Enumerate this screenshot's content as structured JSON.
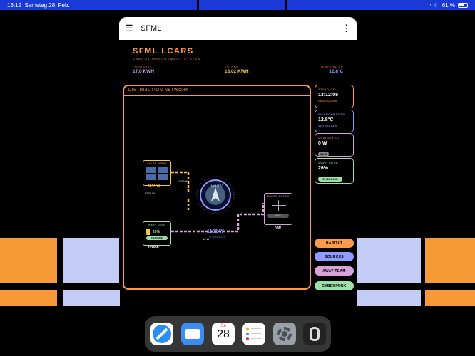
{
  "statusbar": {
    "time": "13:12",
    "date": "Samstag 28. Feb.",
    "battery": "61 %"
  },
  "app": {
    "title": "SFML",
    "brand": "SFML LCARS",
    "brand_sub": "ENERGY MANAGEMENT SYSTEM",
    "metrics": [
      {
        "label": "PROGNOSE",
        "value": "17.0 KWH"
      },
      {
        "label": "ERTRAG",
        "value": "13.02 KWH"
      },
      {
        "label": "TEMPERATUR",
        "value": "12.8°C"
      }
    ]
  },
  "network": {
    "title": "DISTRIBUTION NETWORK",
    "solar": {
      "label": "SOLAR ARRAY",
      "value": "6130 W",
      "flow": "4226 W"
    },
    "warp": {
      "label": "WARP CORE",
      "percent": "26%",
      "state": "CHARGING",
      "value": "4236 W"
    },
    "habitat": {
      "label": "HABITAT",
      "value": "1132 W",
      "sub": "VERBRAUCH"
    },
    "grid": {
      "label": "POWER MATRIX",
      "state": "IDLE",
      "value": "0 W"
    },
    "flow_solar_habitat": "1132 W",
    "flow_warp_grid": "10 W"
  },
  "cards": {
    "stardate": {
      "label": "STARDATE",
      "value": "13:12:08",
      "sub": "SA 28.02.2026"
    },
    "environmental": {
      "label": "ENVIRONMENTAL",
      "value": "12.8°C",
      "sub": "41% WOLKEN"
    },
    "grid": {
      "label": "GRID STATUS",
      "value": "0 W",
      "pill": "IDLE"
    },
    "warp": {
      "label": "WARP CORE",
      "value": "26%",
      "pill": "CHARGING"
    }
  },
  "nav": [
    "HABITAT",
    "SOURCES",
    "AWAY TEAM",
    "CYBERPUNK"
  ],
  "dock": {
    "calendar_day": "Sa",
    "calendar_date": "28",
    "icons": [
      "safari-icon",
      "mail-icon",
      "calendar-icon",
      "reminders-icon",
      "settings-icon",
      "app-icon"
    ]
  },
  "colors": {
    "orange": "#ff9a4a",
    "blue": "#8f9bff",
    "lavender": "#c8a2e8",
    "green": "#9fe0a8",
    "yellow": "#f6c748",
    "pink": "#d9a2d8"
  }
}
